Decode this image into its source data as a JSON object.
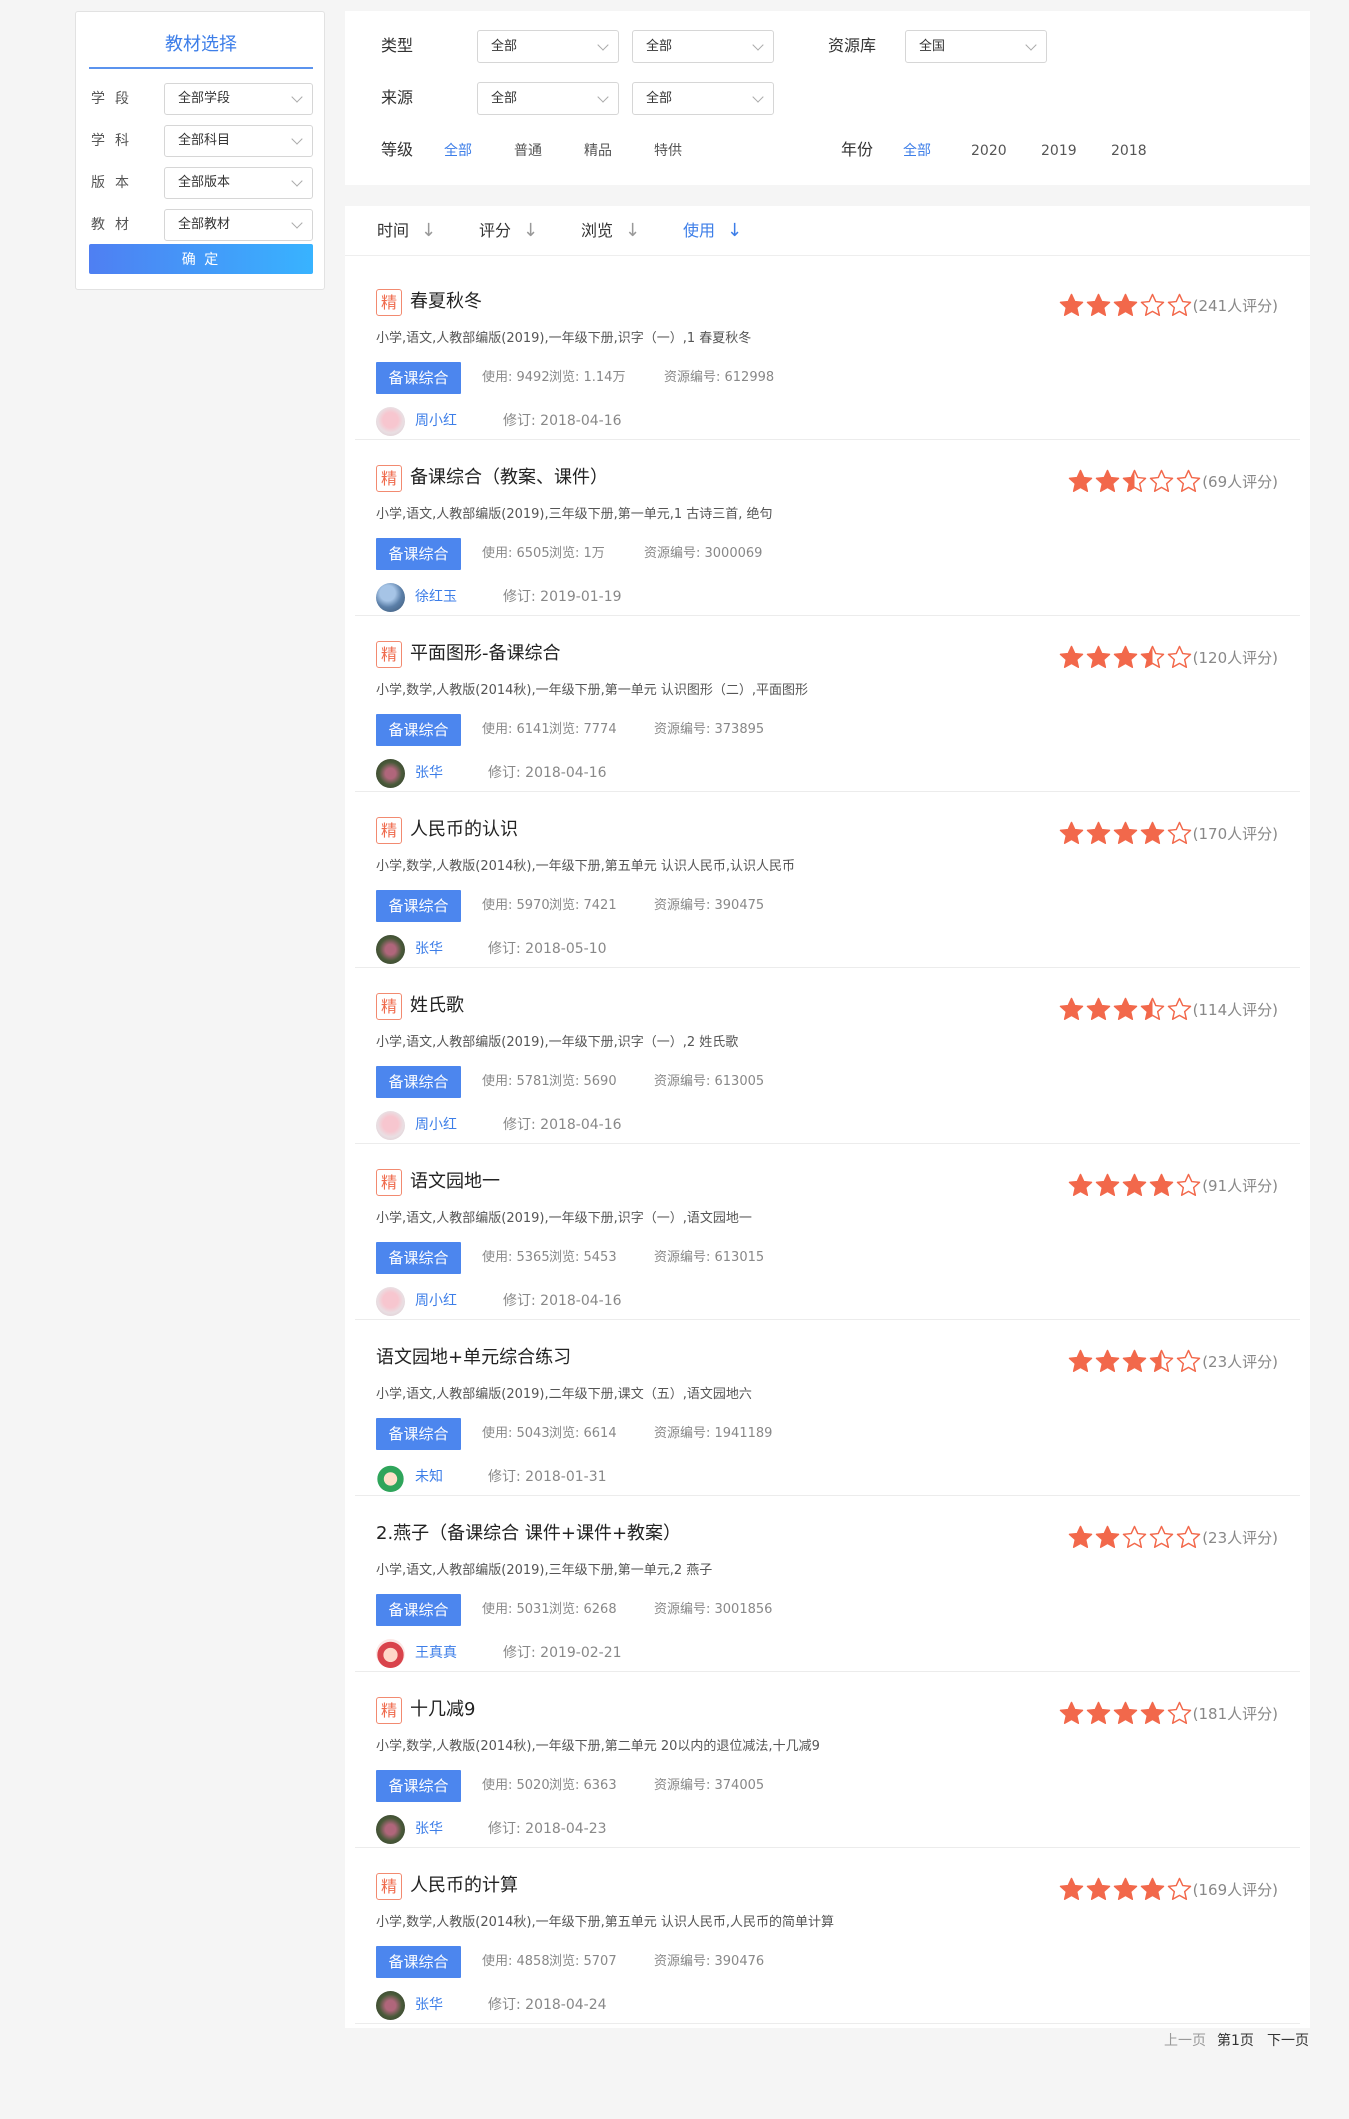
{
  "sidebar": {
    "title": "教材选择",
    "rows": [
      {
        "label": "学段",
        "value": "全部学段"
      },
      {
        "label": "学科",
        "value": "全部科目"
      },
      {
        "label": "版本",
        "value": "全部版本"
      },
      {
        "label": "教材",
        "value": "全部教材"
      }
    ],
    "confirm": "确 定"
  },
  "filters": {
    "type_label": "类型",
    "type_select1": "全部",
    "type_select2": "全部",
    "library_label": "资源库",
    "library_select": "全国",
    "source_label": "来源",
    "source_select1": "全部",
    "source_select2": "全部",
    "level_label": "等级",
    "level_options": [
      "全部",
      "普通",
      "精品",
      "特供"
    ],
    "level_active": "全部",
    "year_label": "年份",
    "year_options": [
      "全部",
      "2020",
      "2019",
      "2018"
    ],
    "year_active": "全部"
  },
  "sort": {
    "options": [
      {
        "label": "时间",
        "active": false
      },
      {
        "label": "评分",
        "active": false
      },
      {
        "label": "浏览",
        "active": false
      },
      {
        "label": "使用",
        "active": true
      }
    ]
  },
  "colors": {
    "accent": "#3d7ee8",
    "star": "#f2684b",
    "tag_bg": "#4c86ee",
    "badge": "#ef6a4c"
  },
  "resources": [
    {
      "badge": "精",
      "title": "春夏秋冬",
      "rating": 3,
      "rating_count": "(241人评分)",
      "path": "小学,语文,人教部编版(2019),一年级下册,识字（一）,1 春夏秋冬",
      "tag": "备课综合",
      "uses": "使用: 9492",
      "views": "浏览: 1.14万",
      "id": "资源编号: 612998",
      "author": "周小红",
      "avatar": "flower",
      "revised": "修订: 2018-04-16"
    },
    {
      "badge": "精",
      "title": "备课综合（教案、课件）",
      "rating": 2.5,
      "rating_count": "(69人评分)",
      "path": "小学,语文,人教部编版(2019),三年级下册,第一单元,1 古诗三首, 绝句",
      "tag": "备课综合",
      "uses": "使用: 6505",
      "views": "浏览: 1万",
      "id": "资源编号: 3000069",
      "author": "徐红玉",
      "avatar": "tree",
      "revised": "修订: 2019-01-19"
    },
    {
      "badge": "精",
      "title": "平面图形-备课综合",
      "rating": 3.5,
      "rating_count": "(120人评分)",
      "path": "小学,数学,人教版(2014秋),一年级下册,第一单元 认识图形（二）,平面图形",
      "tag": "备课综合",
      "uses": "使用: 6141",
      "views": "浏览: 7774",
      "id": "资源编号: 373895",
      "author": "张华",
      "avatar": "lotus",
      "revised": "修订: 2018-04-16"
    },
    {
      "badge": "精",
      "title": "人民币的认识",
      "rating": 4,
      "rating_count": "(170人评分)",
      "path": "小学,数学,人教版(2014秋),一年级下册,第五单元 认识人民币,认识人民币",
      "tag": "备课综合",
      "uses": "使用: 5970",
      "views": "浏览: 7421",
      "id": "资源编号: 390475",
      "author": "张华",
      "avatar": "lotus",
      "revised": "修订: 2018-05-10"
    },
    {
      "badge": "精",
      "title": "姓氏歌",
      "rating": 3.5,
      "rating_count": "(114人评分)",
      "path": "小学,语文,人教部编版(2019),一年级下册,识字（一）,2 姓氏歌",
      "tag": "备课综合",
      "uses": "使用: 5781",
      "views": "浏览: 5690",
      "id": "资源编号: 613005",
      "author": "周小红",
      "avatar": "flower",
      "revised": "修订: 2018-04-16"
    },
    {
      "badge": "精",
      "title": "语文园地一",
      "rating": 4,
      "rating_count": "(91人评分)",
      "path": "小学,语文,人教部编版(2019),一年级下册,识字（一）,语文园地一",
      "tag": "备课综合",
      "uses": "使用: 5365",
      "views": "浏览: 5453",
      "id": "资源编号: 613015",
      "author": "周小红",
      "avatar": "flower",
      "revised": "修订: 2018-04-16"
    },
    {
      "badge": "",
      "title": "语文园地+单元综合练习",
      "rating": 3.5,
      "rating_count": "(23人评分)",
      "path": "小学,语文,人教部编版(2019),二年级下册,课文（五）,语文园地六",
      "tag": "备课综合",
      "uses": "使用: 5043",
      "views": "浏览: 6614",
      "id": "资源编号: 1941189",
      "author": "未知",
      "avatar": "cartoon",
      "revised": "修订: 2018-01-31"
    },
    {
      "badge": "",
      "title": "2.燕子（备课综合 课件+课件+教案）",
      "rating": 2,
      "rating_count": "(23人评分)",
      "path": "小学,语文,人教部编版(2019),三年级下册,第一单元,2 燕子",
      "tag": "备课综合",
      "uses": "使用: 5031",
      "views": "浏览: 6268",
      "id": "资源编号: 3001856",
      "author": "王真真",
      "avatar": "girl",
      "revised": "修订: 2019-02-21"
    },
    {
      "badge": "精",
      "title": "十几减9",
      "rating": 4,
      "rating_count": "(181人评分)",
      "path": "小学,数学,人教版(2014秋),一年级下册,第二单元 20以内的退位减法,十几减9",
      "tag": "备课综合",
      "uses": "使用: 5020",
      "views": "浏览: 6363",
      "id": "资源编号: 374005",
      "author": "张华",
      "avatar": "lotus",
      "revised": "修订: 2018-04-23"
    },
    {
      "badge": "精",
      "title": "人民币的计算",
      "rating": 4,
      "rating_count": "(169人评分)",
      "path": "小学,数学,人教版(2014秋),一年级下册,第五单元 认识人民币,人民币的简单计算",
      "tag": "备课综合",
      "uses": "使用: 4858",
      "views": "浏览: 5707",
      "id": "资源编号: 390476",
      "author": "张华",
      "avatar": "lotus",
      "revised": "修订: 2018-04-24"
    }
  ],
  "pagination": {
    "prev": "上一页",
    "current": "第1页",
    "next": "下一页"
  }
}
